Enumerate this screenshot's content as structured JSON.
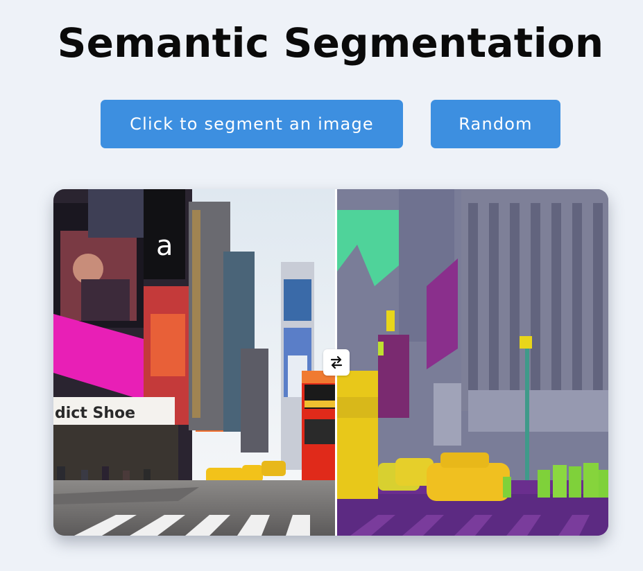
{
  "page": {
    "title": "Semantic Segmentation"
  },
  "toolbar": {
    "segment_label": "Click to segment an image",
    "random_label": "Random"
  },
  "comparison": {
    "original_sign_text": "dict Shoe",
    "slider_icon": "swap-horizontal-icon",
    "slider_position": 0.51
  },
  "colors": {
    "accent": "#3d8fe0",
    "background": "#eef2f8",
    "segment_sky": "#4fd39a",
    "segment_vehicle": "#e8d61a",
    "segment_road": "#6a2e8e",
    "segment_person": "#7fd13a",
    "segment_building": "#7a7d98",
    "segment_sign": "#8a2f8c"
  }
}
